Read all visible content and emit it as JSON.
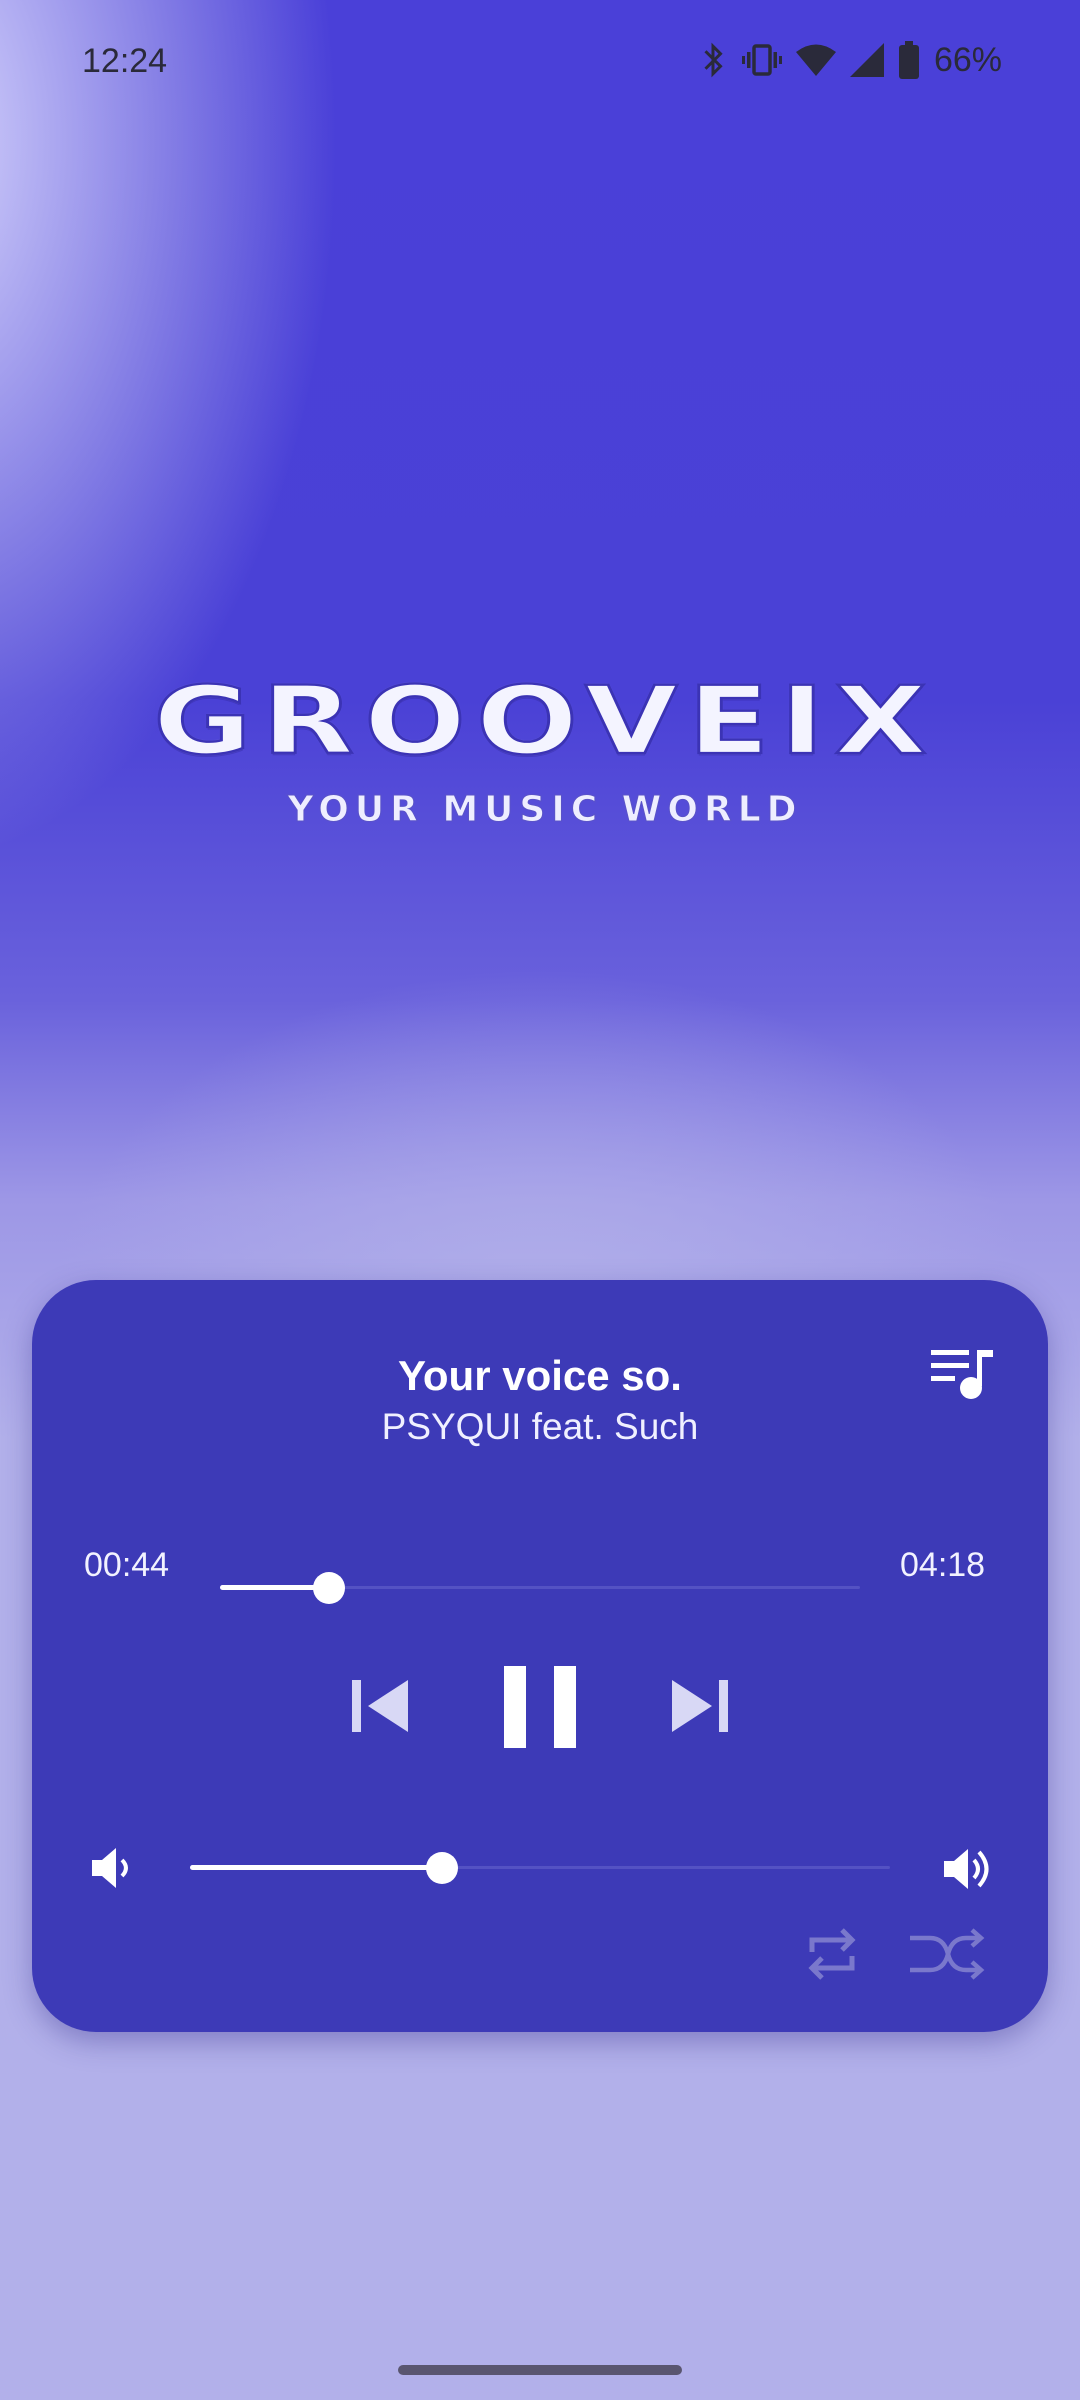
{
  "status_bar": {
    "time": "12:24",
    "battery": "66%",
    "icons": [
      "bluetooth-icon",
      "vibrate-icon",
      "wifi-icon",
      "signal-icon",
      "battery-icon"
    ]
  },
  "logo": {
    "brand": "GROOVEIX",
    "tagline": "YOUR MUSIC WORLD"
  },
  "player": {
    "title": "Your voice so.",
    "artist": "PSYQUI feat. Such",
    "elapsed": "00:44",
    "duration": "04:18",
    "progress_fraction": 0.17,
    "volume_fraction": 0.36,
    "icons": [
      "queue-music-icon",
      "skip-previous-icon",
      "pause-icon",
      "skip-next-icon",
      "volume-down-icon",
      "volume-up-icon",
      "repeat-icon",
      "shuffle-icon"
    ]
  },
  "colors": {
    "card": "#3d3ab7",
    "background_top": "#4a40d8",
    "background_bottom": "#b2b0ea",
    "accent": "#ffffff",
    "inactive_icon": "#7a78cc"
  }
}
